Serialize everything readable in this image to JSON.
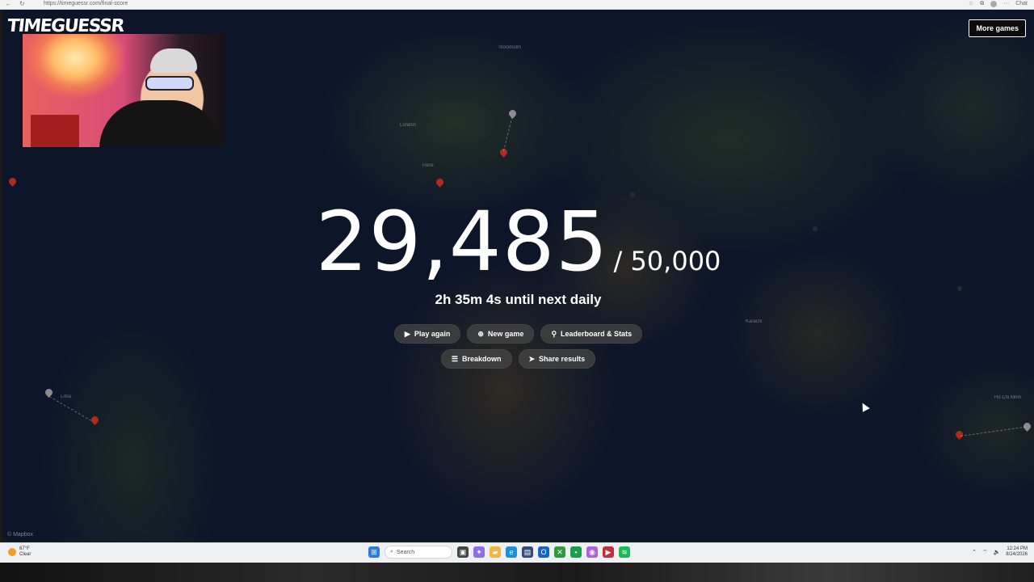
{
  "browser": {
    "url": "https://timeguessr.com/final-score",
    "chat_label": "Chat"
  },
  "site": {
    "logo": "TIMEGUESSR",
    "more_games": "More games"
  },
  "map": {
    "labels": [
      "Stockholm",
      "London",
      "Paris",
      "Lima",
      "Karachi",
      "Ho Chi Minh"
    ],
    "attribution": "© Mapbox"
  },
  "result": {
    "score": "29,485",
    "max_score": "/ 50,000",
    "timer": "2h 35m 4s until next daily"
  },
  "actions": {
    "play_again": "Play again",
    "new_game": "New game",
    "leaderboard": "Leaderboard & Stats",
    "breakdown": "Breakdown",
    "share": "Share results"
  },
  "taskbar": {
    "weather_temp": "67°F",
    "weather_desc": "Clear",
    "search_placeholder": "Search",
    "time": "12:24 PM",
    "date": "8/24/2026"
  },
  "colors": {
    "pin_red": "#b22a1f",
    "pin_grey": "#8c8c8c",
    "ocean": "#101a30"
  }
}
